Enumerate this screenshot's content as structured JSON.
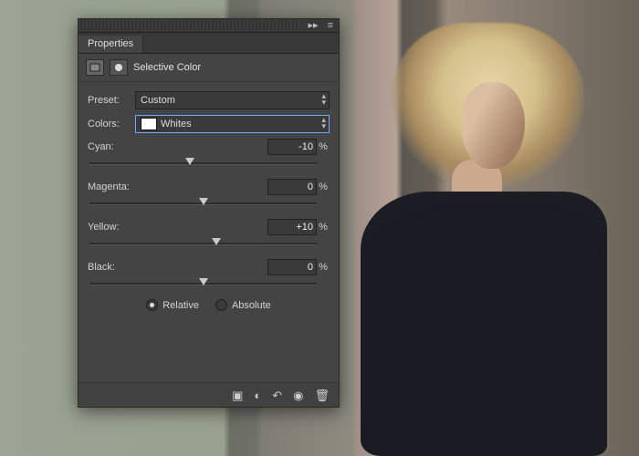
{
  "panel": {
    "title": "Properties",
    "section_title": "Selective Color",
    "preset_label": "Preset:",
    "preset_value": "Custom",
    "colors_label": "Colors:",
    "colors_value": "Whites",
    "colors_swatch": "#ffffff",
    "sliders": [
      {
        "label": "Cyan:",
        "value": "-10",
        "pos": 44
      },
      {
        "label": "Magenta:",
        "value": "0",
        "pos": 50
      },
      {
        "label": "Yellow:",
        "value": "+10",
        "pos": 56
      },
      {
        "label": "Black:",
        "value": "0",
        "pos": 50
      }
    ],
    "percent": "%",
    "method": {
      "relative": "Relative",
      "absolute": "Absolute",
      "selected": "relative"
    }
  }
}
